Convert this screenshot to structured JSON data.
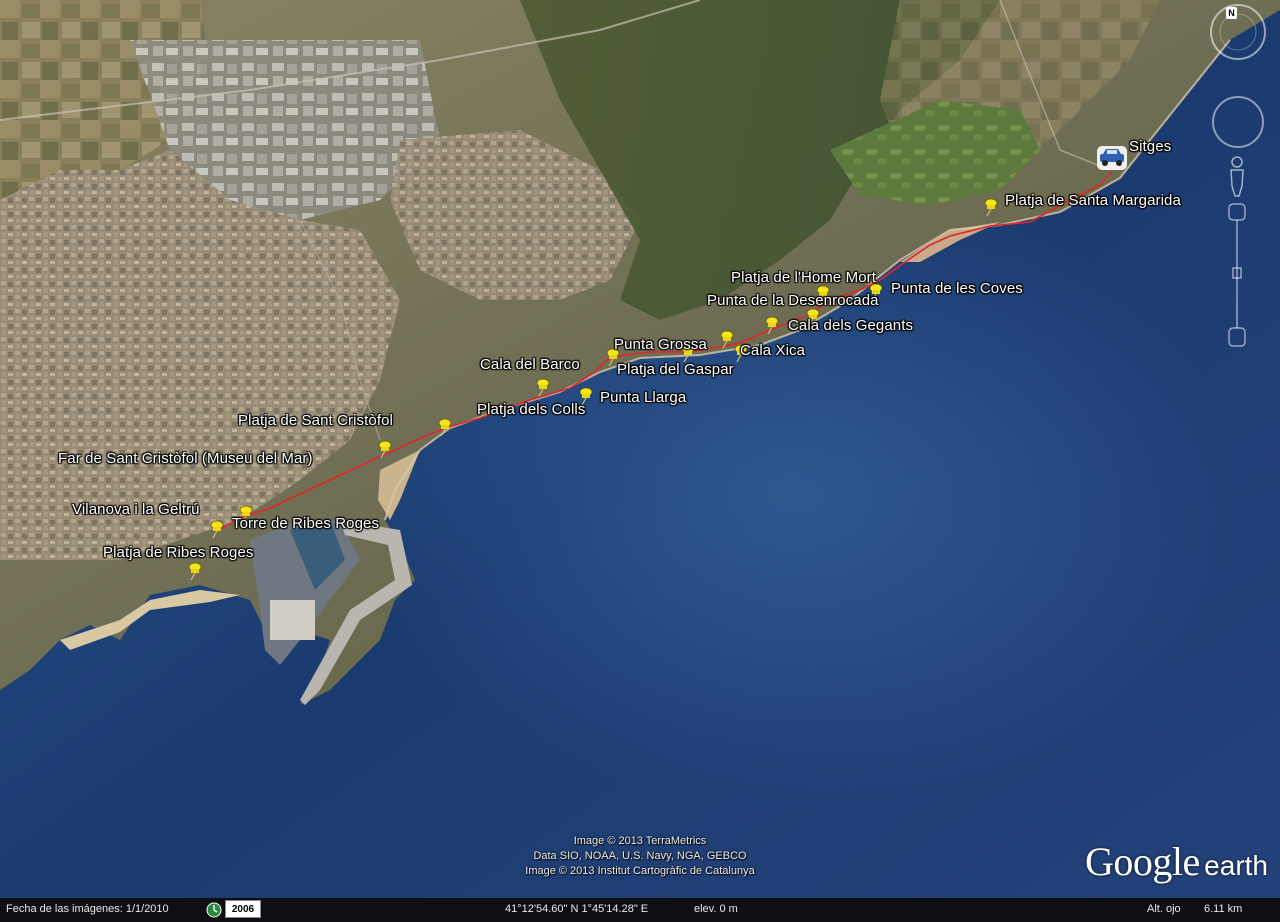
{
  "app": "Google Earth",
  "colors": {
    "sea_deep": "#1e3f74",
    "route": "#e3262a",
    "pin": "#f5e51b",
    "label_text": "#ffffff",
    "statusbar_bg": "#0d0f12"
  },
  "map": {
    "labels": {
      "sitges": "Sitges",
      "santa_margarida": "Platja de Santa Margarida",
      "home_mort": "Platja de l'Home Mort",
      "punta_coves": "Punta de les Coves",
      "punta_desenrocada": "Punta de la Desenrocada",
      "cala_gegants": "Cala dels Gegants",
      "punta_grossa": "Punta Grossa",
      "cala_xica": "Cala Xica",
      "cala_barco": "Cala del Barco",
      "platja_gaspar": "Platja del Gaspar",
      "punta_llarga": "Punta Llarga",
      "platja_colls": "Platja dels Colls",
      "platja_sant_cristofol": "Platja de Sant Cristòfol",
      "far_sant_cristofol": "Far de Sant Cristòfol (Museu del Mar)",
      "vilanova": "Vilanova i la Geltrú",
      "torre_ribes": "Torre de Ribes Roges",
      "platja_ribes": "Platja de Ribes Roges"
    },
    "marker_icons": {
      "default": "yellow-pushpin-icon",
      "sitges": "car-icon"
    }
  },
  "attribution": {
    "line1": "Image © 2013 TerraMetrics",
    "line2": "Data SIO, NOAA, U.S. Navy, NGA, GEBCO",
    "line3": "Image © 2013 Institut Cartogràfic de Catalunya"
  },
  "logo": {
    "google": "Google",
    "earth": "earth"
  },
  "status": {
    "imagery_date": "Fecha de las imágenes: 1/1/2010",
    "history_year": "2006",
    "coordinates": "41°12'54.60\" N    1°45'14.28\" E",
    "elevation": "elev.       0 m",
    "eye_alt_label": "Alt. ojo",
    "eye_alt_value": "6.11 km"
  },
  "nav": {
    "north": "N"
  }
}
